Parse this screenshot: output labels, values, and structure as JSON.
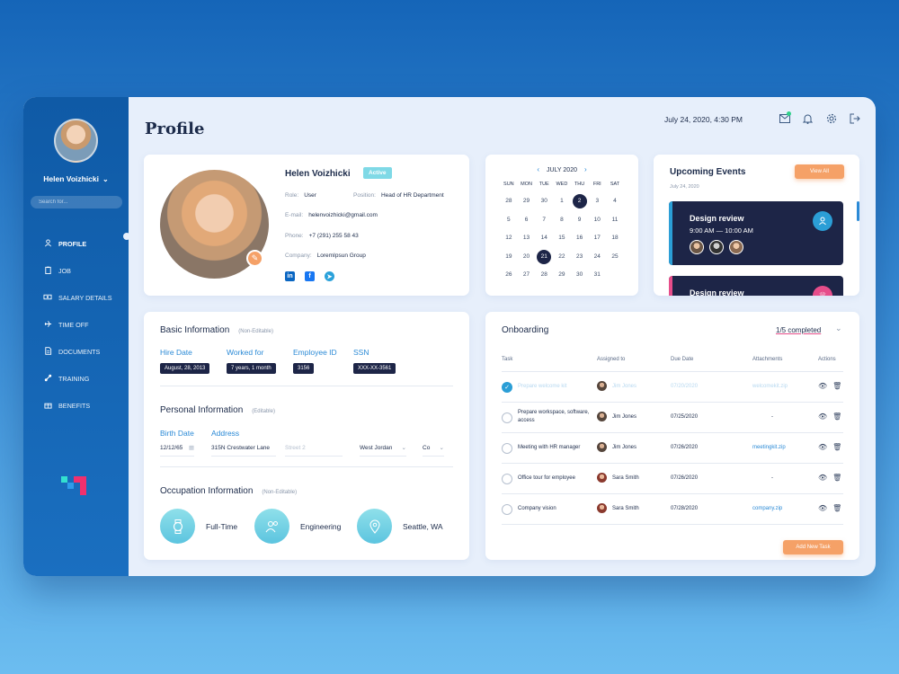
{
  "sidebar": {
    "user_name": "Helen Voizhicki",
    "search_placeholder": "Search for...",
    "items": [
      {
        "label": "PROFILE",
        "icon": "person-icon"
      },
      {
        "label": "JOB",
        "icon": "clipboard-icon"
      },
      {
        "label": "SALARY DETAILS",
        "icon": "money-icon"
      },
      {
        "label": "TIME OFF",
        "icon": "airplane-icon"
      },
      {
        "label": "DOCUMENTS",
        "icon": "document-icon"
      },
      {
        "label": "TRAINING",
        "icon": "training-icon"
      },
      {
        "label": "BENEFITS",
        "icon": "gift-icon"
      }
    ]
  },
  "header": {
    "title": "Profile",
    "datetime": "July 24, 2020, 4:30 PM",
    "icons": [
      "mail-icon",
      "bell-icon",
      "gear-icon",
      "logout-icon"
    ]
  },
  "profile": {
    "name": "Helen Voizhicki",
    "status": "Active",
    "role_label": "Role:",
    "role": "User",
    "position_label": "Position:",
    "position": "Head of HR Department",
    "email_label": "E-mail:",
    "email": "helenvoizhicki@gmail.com",
    "phone_label": "Phone:",
    "phone": "+7 (291) 255 58 43",
    "company_label": "Company:",
    "company": "LoremIpsun Group"
  },
  "calendar": {
    "month": "JULY 2020",
    "weekdays": [
      "SUN",
      "MON",
      "TUE",
      "WED",
      "THU",
      "FRI",
      "SAT"
    ],
    "days": [
      "28",
      "29",
      "30",
      "1",
      "2",
      "3",
      "4",
      "5",
      "6",
      "7",
      "8",
      "9",
      "10",
      "11",
      "12",
      "13",
      "14",
      "15",
      "16",
      "17",
      "18",
      "19",
      "20",
      "21",
      "22",
      "23",
      "24",
      "25",
      "26",
      "27",
      "28",
      "29",
      "30",
      "31",
      ""
    ],
    "selected": [
      "2",
      "21"
    ]
  },
  "events": {
    "title": "Upcoming Events",
    "date": "July 24, 2020",
    "view_all": "View All",
    "items": [
      {
        "title": "Design review",
        "time": "9:00 AM — 10:00 AM",
        "stripe_color": "#2b9ed6",
        "icon_color": "#2b9ed6"
      },
      {
        "title": "Design review",
        "time": "",
        "stripe_color": "#e64d8a",
        "icon_color": "#e64d8a"
      }
    ]
  },
  "basic": {
    "title": "Basic Information",
    "note": "(Non-Editable)",
    "fields": [
      {
        "label": "Hire Date",
        "value": "August, 28, 2013"
      },
      {
        "label": "Worked for",
        "value": "7 years, 1 month"
      },
      {
        "label": "Employee ID",
        "value": "3156"
      },
      {
        "label": "SSN",
        "value": "XXX-XX-3561"
      }
    ]
  },
  "personal": {
    "title": "Personal Information",
    "note": "(Editable)",
    "birth_label": "Birth Date",
    "address_label": "Address",
    "birth_date": "12/12/65",
    "street1": "315N Crestwater Lane",
    "street2_placeholder": "Street 2",
    "city": "West Jordan",
    "state": "Co"
  },
  "occupation": {
    "title": "Occupation Information",
    "note": "(Non-Editable)",
    "items": [
      {
        "label": "Full-Time",
        "icon": "watch-icon"
      },
      {
        "label": "Engineering",
        "icon": "people-icon"
      },
      {
        "label": "Seattle, WA",
        "icon": "location-pin-icon"
      }
    ]
  },
  "onboarding": {
    "title": "Onboarding",
    "completed": "1/5 completed",
    "headers": [
      "Task",
      "Assigned to",
      "Due Date",
      "Attachments",
      "Actions"
    ],
    "rows": [
      {
        "task": "Prepare welcome kit",
        "assignee": "Jim Jones",
        "due": "07/20/2020",
        "attachment": "welcomekit.zip",
        "done": true
      },
      {
        "task": "Prepare workspace, software, access",
        "assignee": "Jim Jones",
        "due": "07/25/2020",
        "attachment": "-",
        "done": false
      },
      {
        "task": "Meeting with HR manager",
        "assignee": "Jim Jones",
        "due": "07/26/2020",
        "attachment": "meetingkit.zip",
        "done": false
      },
      {
        "task": "Office tour for employee",
        "assignee": "Sara Smith",
        "due": "07/26/2020",
        "attachment": "-",
        "done": false
      },
      {
        "task": "Company vision",
        "assignee": "Sara Smith",
        "due": "07/28/2020",
        "attachment": "company.zip",
        "done": false
      }
    ],
    "add_button": "Add New Task"
  }
}
